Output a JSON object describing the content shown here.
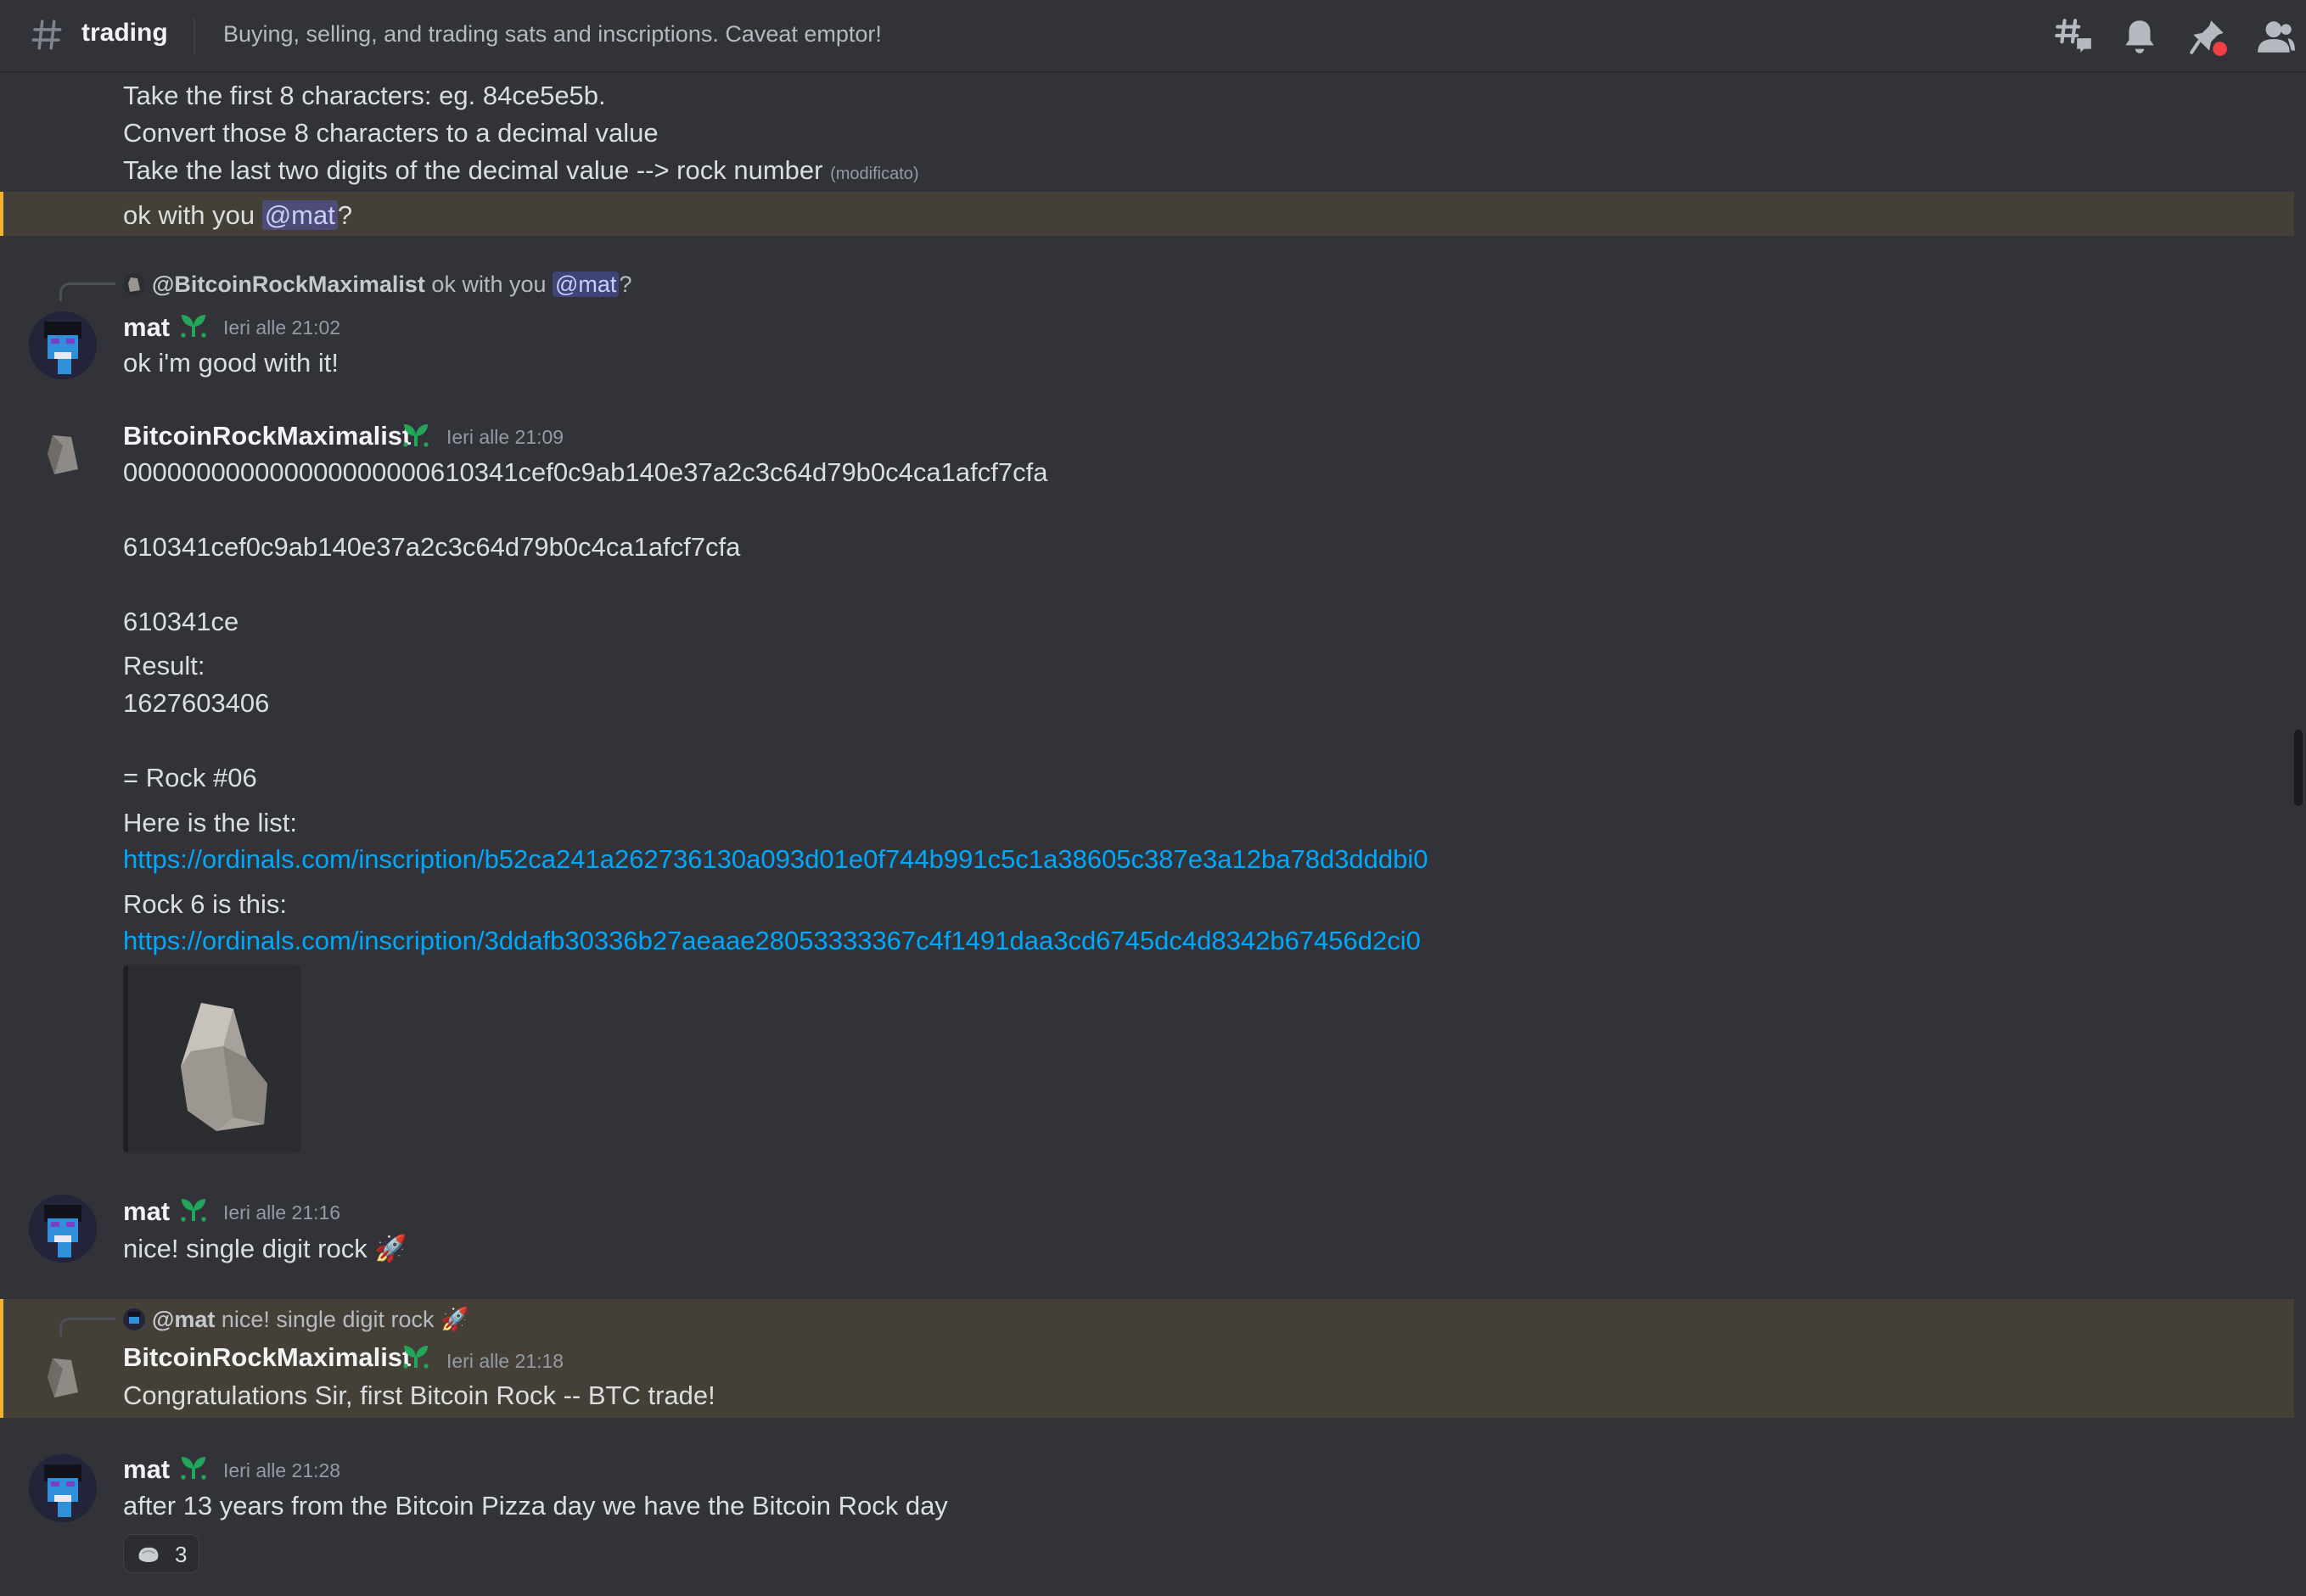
{
  "header": {
    "channel_name": "trading",
    "topic": "Buying, selling, and trading sats and inscriptions. Caveat emptor!",
    "icons": [
      "threads-icon",
      "bell-icon",
      "pin-icon",
      "members-icon"
    ]
  },
  "colors": {
    "background": "#313338",
    "highlight": "#454037",
    "highlight_bar": "#f0b232",
    "link": "#00a8fc",
    "mention": "#c9cdfb",
    "unread_dot": "#f23f43"
  },
  "messages": {
    "top": {
      "line1": "Take the first 8 characters: eg. 84ce5e5b.",
      "line2": "Convert those 8 characters to a decimal value",
      "line3": "Take the last two digits of the decimal value --> rock number",
      "edited": "(modificato)",
      "hl_text": "ok with you",
      "hl_mention": "@mat",
      "hl_after": "?"
    },
    "m1": {
      "reply_name": "@BitcoinRockMaximalist",
      "reply_text": "ok with you",
      "reply_mention": "@mat",
      "reply_after": "?",
      "author": "mat",
      "timestamp": "Ieri alle 21:02",
      "text": "ok i'm good with it!"
    },
    "m2": {
      "author": "BitcoinRockMaximalist",
      "timestamp": "Ieri alle 21:09",
      "l1": "000000000000000000000610341cef0c9ab140e37a2c3c64d79b0c4ca1afcf7cfa",
      "l2": "610341cef0c9ab140e37a2c3c64d79b0c4ca1afcf7cfa",
      "l3": "610341ce",
      "l4": "Result:",
      "l5": "1627603406",
      "l6": "= Rock #06",
      "l7": "Here is the list:",
      "link1": "https://ordinals.com/inscription/b52ca241a262736130a093d01e0f744b991c5c1a38605c387e3a12ba78d3dddbi0",
      "l8": "Rock 6 is this:",
      "link2": "https://ordinals.com/inscription/3ddafb30336b27aeaae28053333367c4f1491daa3cd6745dc4d8342b67456d2ci0"
    },
    "m3": {
      "author": "mat",
      "timestamp": "Ieri alle 21:16",
      "text": "nice! single digit rock",
      "emoji": "🚀"
    },
    "m4": {
      "reply_name": "@mat",
      "reply_text": "nice! single digit rock",
      "reply_emoji": "🚀",
      "author": "BitcoinRockMaximalist",
      "timestamp": "Ieri alle 21:18",
      "text": "Congratulations Sir, first Bitcoin Rock -- BTC trade!"
    },
    "m5": {
      "author": "mat",
      "timestamp": "Ieri alle 21:28",
      "text": "after 13 years from the Bitcoin Pizza day we have the Bitcoin Rock day",
      "reaction_icon": "rock-icon",
      "reaction_count": "3"
    }
  }
}
